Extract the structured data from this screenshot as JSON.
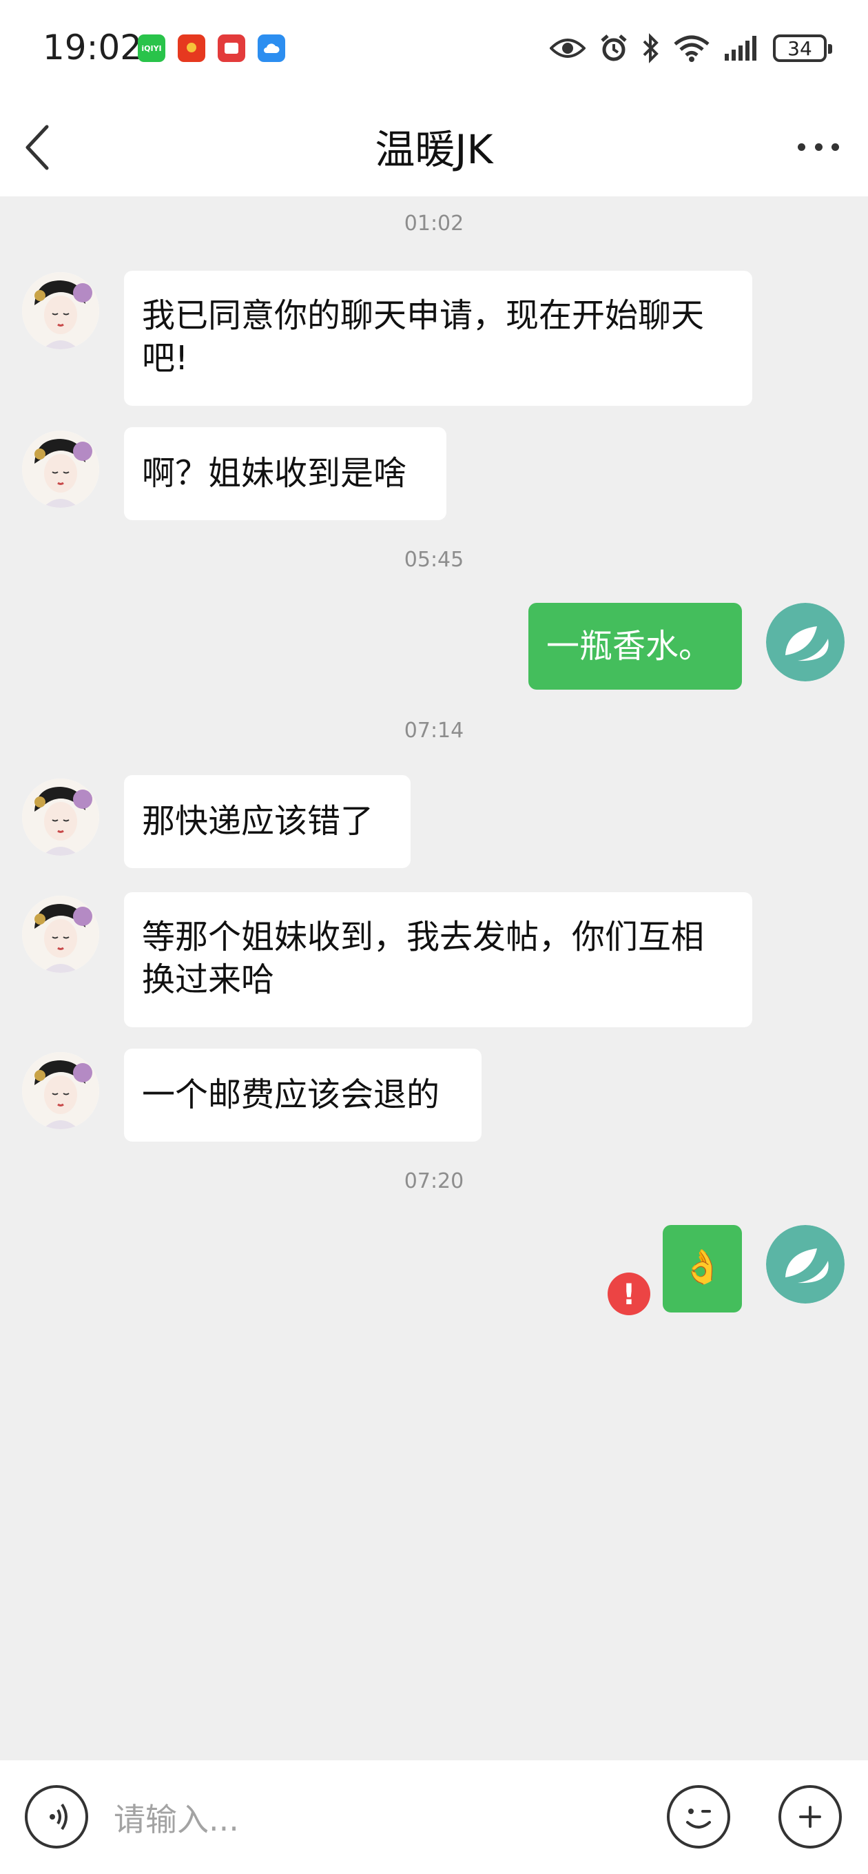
{
  "status_bar": {
    "time": "19:02",
    "app_icons": [
      {
        "name": "iqiyi-icon",
        "text": "iQIYI",
        "color": "#29c34a"
      },
      {
        "name": "red-packet-icon",
        "text": "",
        "color": "#e6391f"
      },
      {
        "name": "red-app-icon",
        "text": "",
        "color": "#e33b3b"
      },
      {
        "name": "cloud-icon",
        "text": "",
        "color": "#2c8ef0"
      }
    ],
    "battery": "34"
  },
  "header": {
    "title": "温暖JK"
  },
  "messages": [
    {
      "type": "timestamp",
      "text": "01:02"
    },
    {
      "type": "incoming",
      "text": "我已同意你的聊天申请，现在开始聊天吧!"
    },
    {
      "type": "incoming",
      "text": "啊？姐妹收到是啥"
    },
    {
      "type": "timestamp",
      "text": "05:45"
    },
    {
      "type": "outgoing",
      "text": "一瓶香水。"
    },
    {
      "type": "timestamp",
      "text": "07:14"
    },
    {
      "type": "incoming",
      "text": "那快递应该错了"
    },
    {
      "type": "incoming",
      "text": "等那个姐妹收到，我去发帖，你们互相换过来哈"
    },
    {
      "type": "incoming",
      "text": "一个邮费应该会退的"
    },
    {
      "type": "timestamp",
      "text": "07:20"
    },
    {
      "type": "outgoing",
      "text": "👌",
      "failed": true,
      "error_mark": "!"
    }
  ],
  "input_bar": {
    "placeholder": "请输入..."
  },
  "colors": {
    "outgoing_bubble": "#44be5c",
    "incoming_bubble": "#ffffff",
    "chat_background": "#efefef",
    "error": "#ec4444"
  }
}
